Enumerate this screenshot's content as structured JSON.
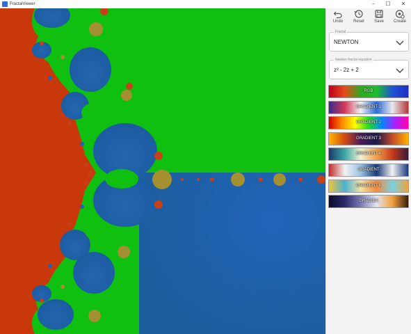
{
  "window": {
    "title": "FractalViewer",
    "minimize_glyph": "–",
    "maximize_glyph": "☐",
    "close_glyph": "✕"
  },
  "toolbar": {
    "undo": {
      "label": "Undo",
      "icon": "undo-icon"
    },
    "reset": {
      "label": "Reset",
      "icon": "reset-icon"
    },
    "save": {
      "label": "Save",
      "icon": "save-icon"
    },
    "create": {
      "label": "Create",
      "icon": "create-icon"
    }
  },
  "fractal_select": {
    "label": "Fractal",
    "value": "NEWTON"
  },
  "equation_select": {
    "label": "Newton fractal equation",
    "value": "z³ - 2z + 2"
  },
  "gradients": [
    {
      "label": "RGB",
      "colors": [
        "#c0001c",
        "#e84b1c",
        "#31a81e",
        "#19bf2c",
        "#1f52d6",
        "#1f2fbf"
      ]
    },
    {
      "label": "GRADIENT 1",
      "colors": [
        "#3a2a8a",
        "#d23a5a",
        "#f2f2f2",
        "#2a6ad2",
        "#e8e8f0",
        "#b23a3a"
      ]
    },
    {
      "label": "GRADIENT 2",
      "colors": [
        "#d00000",
        "#ff8800",
        "#ffff00",
        "#22dd22",
        "#0088ff",
        "#aa22ff",
        "#ff00aa"
      ]
    },
    {
      "label": "GRADIENT 3",
      "colors": [
        "#ffb400",
        "#d24a12",
        "#4a1a5a",
        "#1a1a4a",
        "#c44a2a",
        "#ffb400"
      ]
    },
    {
      "label": "GRADIENT 4",
      "colors": [
        "#1a3a6a",
        "#3aa8a8",
        "#f2f2d2",
        "#f2a24a",
        "#c43a1a",
        "#3a1a3a"
      ]
    },
    {
      "label": "GRADIENT",
      "colors": [
        "#c42a2a",
        "#f2f2f2",
        "#9ac2e2",
        "#1a3a7a",
        "#f2f2f2",
        "#1a3a7a"
      ]
    },
    {
      "label": "GRADIENT 6",
      "colors": [
        "#f2c23a",
        "#4ab2d2",
        "#f2e2a2",
        "#f28a3a",
        "#7ad2e2",
        "#f2a23a"
      ]
    },
    {
      "label": "GRADIEN",
      "colors": [
        "#0a0a2a",
        "#2a2a6a",
        "#7a7ab2",
        "#e2e2f2",
        "#f2a23a",
        "#3a1a0a"
      ]
    }
  ],
  "fractal": {
    "colors": {
      "root_orange": "#c8380a",
      "root_green": "#10c010",
      "root_blue": "#1f64a8",
      "blue_dark": "#1b5a9c",
      "blob_gold": "#a49030",
      "blob_red": "#c8401a"
    }
  }
}
